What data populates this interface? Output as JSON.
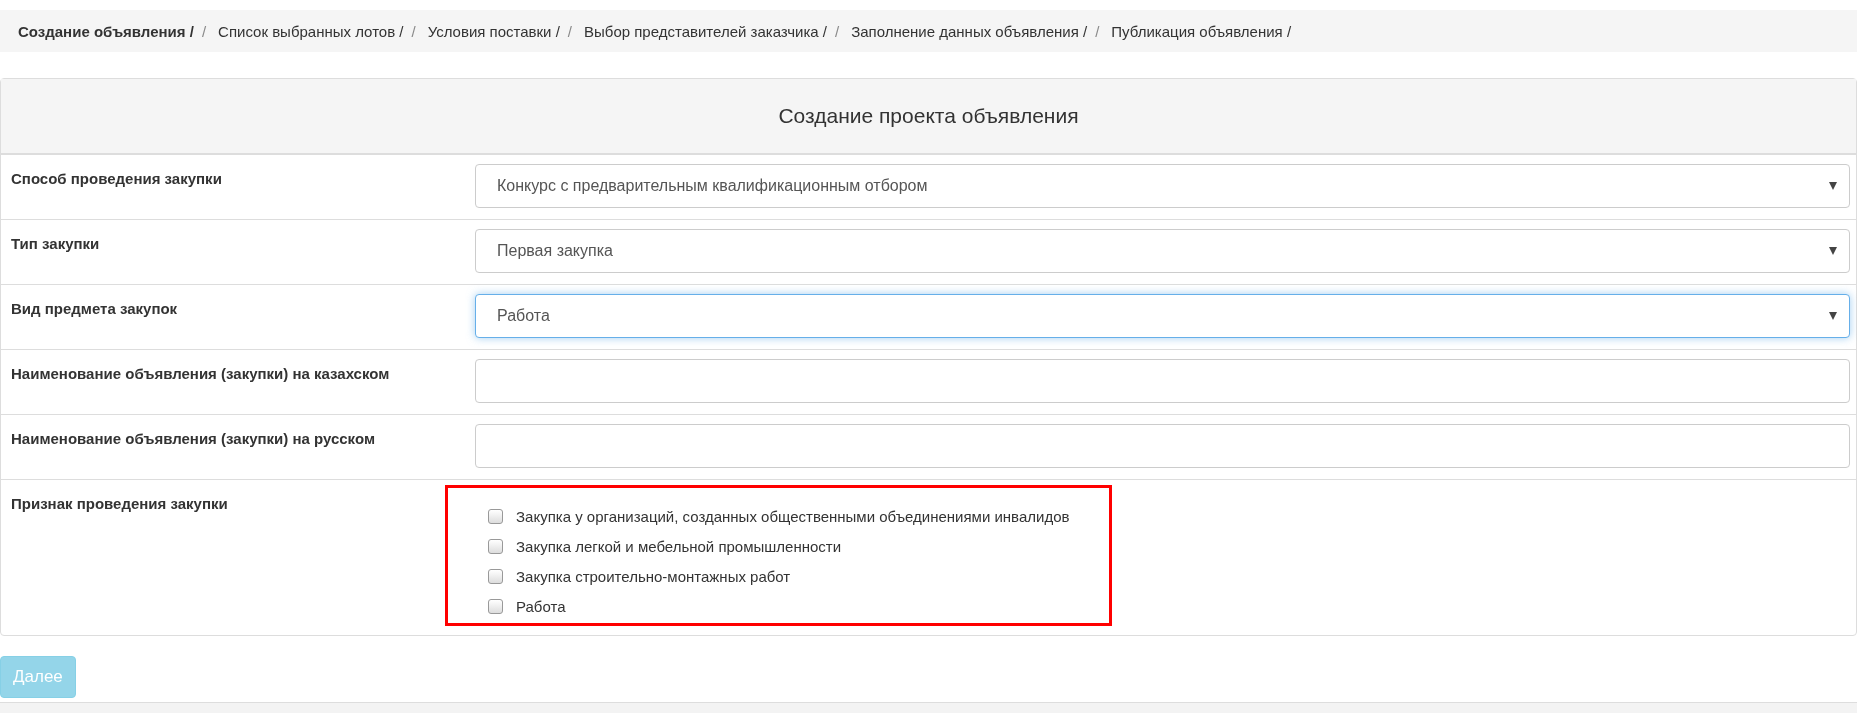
{
  "breadcrumb": [
    {
      "label": "Создание объявления /",
      "selected": true,
      "separator": "/"
    },
    {
      "label": "Список выбранных лотов /",
      "selected": false,
      "separator": "/"
    },
    {
      "label": "Условия поставки /",
      "selected": false,
      "separator": "/"
    },
    {
      "label": "Выбор представителей заказчика /",
      "selected": false,
      "separator": "/"
    },
    {
      "label": "Заполнение данных объявления /",
      "selected": false,
      "separator": "/"
    },
    {
      "label": "Публикация объявления /",
      "selected": false
    }
  ],
  "panel": {
    "title": "Создание проекта объявления",
    "rows": [
      {
        "kind": "select",
        "label": "Способ проведения закупки",
        "value": "Конкурс с предварительным квалификационным отбором",
        "focused": false
      },
      {
        "kind": "select",
        "label": "Тип закупки",
        "value": "Первая закупка",
        "focused": false
      },
      {
        "kind": "select",
        "label": "Вид предмета закупок",
        "value": "Работа",
        "focused": true
      },
      {
        "kind": "text",
        "label": "Наименование объявления (закупки) на казахском",
        "focused": false
      },
      {
        "kind": "text",
        "label": "Наименование объявления (закупки) на русском",
        "focused": false
      },
      {
        "kind": "checkboxes",
        "label": "Признак проведения закупки",
        "highlighted": true,
        "options": [
          {
            "label": "Закупка у организаций, созданных общественными объединениями инвалидов",
            "checked": false
          },
          {
            "label": "Закупка легкой и мебельной промышленности",
            "checked": false
          },
          {
            "label": "Закупка строительно-монтажных работ",
            "checked": false
          },
          {
            "label": "Работа",
            "checked": false
          }
        ]
      }
    ]
  },
  "next_button": {
    "label": "Далее",
    "disabled": true
  }
}
